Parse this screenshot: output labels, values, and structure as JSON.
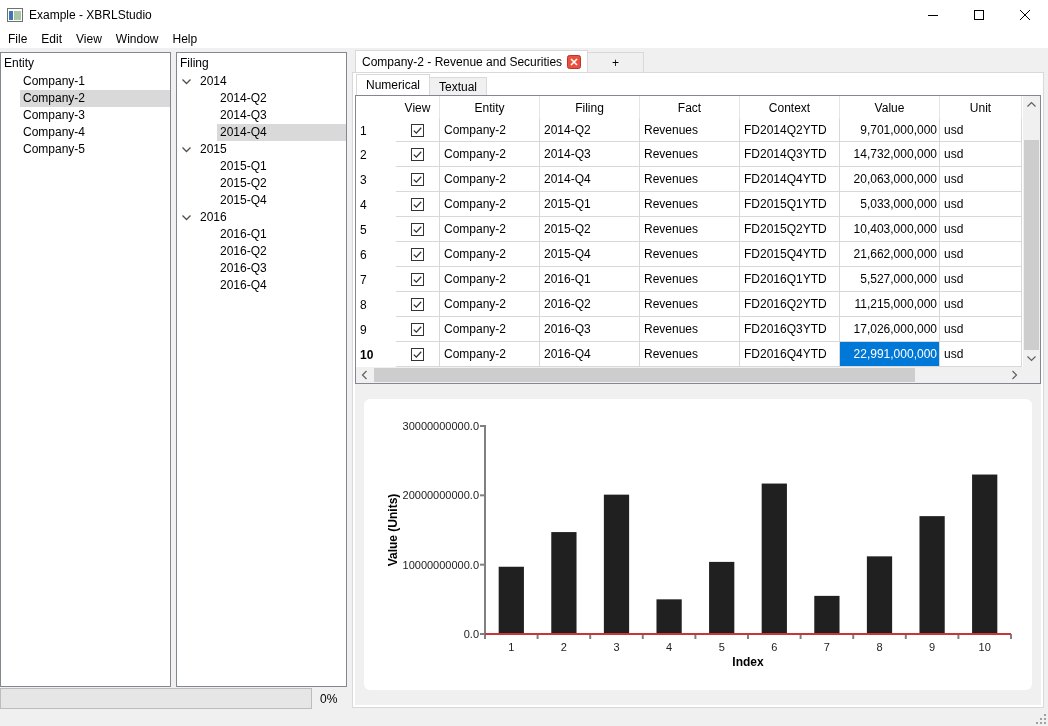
{
  "window": {
    "title": "Example - XBRLStudio"
  },
  "menu": [
    "File",
    "Edit",
    "View",
    "Window",
    "Help"
  ],
  "entity_panel": {
    "header": "Entity",
    "items": [
      {
        "label": "Company-1",
        "selected": false
      },
      {
        "label": "Company-2",
        "selected": true
      },
      {
        "label": "Company-3",
        "selected": false
      },
      {
        "label": "Company-4",
        "selected": false
      },
      {
        "label": "Company-5",
        "selected": false
      }
    ]
  },
  "filing_panel": {
    "header": "Filing",
    "items": [
      {
        "label": "2014",
        "selected": false,
        "expanded": true,
        "children": [
          {
            "label": "2014-Q2",
            "selected": false
          },
          {
            "label": "2014-Q3",
            "selected": false
          },
          {
            "label": "2014-Q4",
            "selected": true
          }
        ]
      },
      {
        "label": "2015",
        "selected": false,
        "expanded": true,
        "children": [
          {
            "label": "2015-Q1",
            "selected": false
          },
          {
            "label": "2015-Q2",
            "selected": false
          },
          {
            "label": "2015-Q4",
            "selected": false
          }
        ]
      },
      {
        "label": "2016",
        "selected": false,
        "expanded": true,
        "children": [
          {
            "label": "2016-Q1",
            "selected": false
          },
          {
            "label": "2016-Q2",
            "selected": false
          },
          {
            "label": "2016-Q3",
            "selected": false
          },
          {
            "label": "2016-Q4",
            "selected": false
          }
        ]
      }
    ]
  },
  "progress": {
    "level": 0,
    "reading": "0%"
  },
  "document_tabs": [
    {
      "label": "Company-2 - Revenue and Securities",
      "selected": true,
      "closable": true
    },
    {
      "label": "+",
      "selected": false,
      "closable": false
    }
  ],
  "view_tabs": [
    {
      "label": "Numerical",
      "selected": true
    },
    {
      "label": "Textual",
      "selected": false
    }
  ],
  "table": {
    "columns": [
      "View",
      "Entity",
      "Filing",
      "Fact",
      "Context",
      "Value",
      "Unit"
    ],
    "rows": [
      {
        "index": "1",
        "cells": [
          {
            "kind": "checkbox",
            "checked": true
          },
          {
            "kind": "text",
            "text": "Company-2",
            "selected": false
          },
          {
            "kind": "text",
            "text": "2014-Q2",
            "selected": false
          },
          {
            "kind": "text",
            "text": "Revenues",
            "selected": false
          },
          {
            "kind": "text",
            "text": "FD2014Q2YTD",
            "selected": false
          },
          {
            "kind": "number",
            "text": "9,701,000,000",
            "selected": false
          },
          {
            "kind": "text",
            "text": "usd",
            "selected": false
          }
        ]
      },
      {
        "index": "2",
        "cells": [
          {
            "kind": "checkbox",
            "checked": true
          },
          {
            "kind": "text",
            "text": "Company-2",
            "selected": false
          },
          {
            "kind": "text",
            "text": "2014-Q3",
            "selected": false
          },
          {
            "kind": "text",
            "text": "Revenues",
            "selected": false
          },
          {
            "kind": "text",
            "text": "FD2014Q3YTD",
            "selected": false
          },
          {
            "kind": "number",
            "text": "14,732,000,000",
            "selected": false
          },
          {
            "kind": "text",
            "text": "usd",
            "selected": false
          }
        ]
      },
      {
        "index": "3",
        "cells": [
          {
            "kind": "checkbox",
            "checked": true
          },
          {
            "kind": "text",
            "text": "Company-2",
            "selected": false
          },
          {
            "kind": "text",
            "text": "2014-Q4",
            "selected": false
          },
          {
            "kind": "text",
            "text": "Revenues",
            "selected": false
          },
          {
            "kind": "text",
            "text": "FD2014Q4YTD",
            "selected": false
          },
          {
            "kind": "number",
            "text": "20,063,000,000",
            "selected": false
          },
          {
            "kind": "text",
            "text": "usd",
            "selected": false
          }
        ]
      },
      {
        "index": "4",
        "cells": [
          {
            "kind": "checkbox",
            "checked": true
          },
          {
            "kind": "text",
            "text": "Company-2",
            "selected": false
          },
          {
            "kind": "text",
            "text": "2015-Q1",
            "selected": false
          },
          {
            "kind": "text",
            "text": "Revenues",
            "selected": false
          },
          {
            "kind": "text",
            "text": "FD2015Q1YTD",
            "selected": false
          },
          {
            "kind": "number",
            "text": "5,033,000,000",
            "selected": false
          },
          {
            "kind": "text",
            "text": "usd",
            "selected": false
          }
        ]
      },
      {
        "index": "5",
        "cells": [
          {
            "kind": "checkbox",
            "checked": true
          },
          {
            "kind": "text",
            "text": "Company-2",
            "selected": false
          },
          {
            "kind": "text",
            "text": "2015-Q2",
            "selected": false
          },
          {
            "kind": "text",
            "text": "Revenues",
            "selected": false
          },
          {
            "kind": "text",
            "text": "FD2015Q2YTD",
            "selected": false
          },
          {
            "kind": "number",
            "text": "10,403,000,000",
            "selected": false
          },
          {
            "kind": "text",
            "text": "usd",
            "selected": false
          }
        ]
      },
      {
        "index": "6",
        "cells": [
          {
            "kind": "checkbox",
            "checked": true
          },
          {
            "kind": "text",
            "text": "Company-2",
            "selected": false
          },
          {
            "kind": "text",
            "text": "2015-Q4",
            "selected": false
          },
          {
            "kind": "text",
            "text": "Revenues",
            "selected": false
          },
          {
            "kind": "text",
            "text": "FD2015Q4YTD",
            "selected": false
          },
          {
            "kind": "number",
            "text": "21,662,000,000",
            "selected": false
          },
          {
            "kind": "text",
            "text": "usd",
            "selected": false
          }
        ]
      },
      {
        "index": "7",
        "cells": [
          {
            "kind": "checkbox",
            "checked": true
          },
          {
            "kind": "text",
            "text": "Company-2",
            "selected": false
          },
          {
            "kind": "text",
            "text": "2016-Q1",
            "selected": false
          },
          {
            "kind": "text",
            "text": "Revenues",
            "selected": false
          },
          {
            "kind": "text",
            "text": "FD2016Q1YTD",
            "selected": false
          },
          {
            "kind": "number",
            "text": "5,527,000,000",
            "selected": false
          },
          {
            "kind": "text",
            "text": "usd",
            "selected": false
          }
        ]
      },
      {
        "index": "8",
        "cells": [
          {
            "kind": "checkbox",
            "checked": true
          },
          {
            "kind": "text",
            "text": "Company-2",
            "selected": false
          },
          {
            "kind": "text",
            "text": "2016-Q2",
            "selected": false
          },
          {
            "kind": "text",
            "text": "Revenues",
            "selected": false
          },
          {
            "kind": "text",
            "text": "FD2016Q2YTD",
            "selected": false
          },
          {
            "kind": "number",
            "text": "11,215,000,000",
            "selected": false
          },
          {
            "kind": "text",
            "text": "usd",
            "selected": false
          }
        ]
      },
      {
        "index": "9",
        "cells": [
          {
            "kind": "checkbox",
            "checked": true
          },
          {
            "kind": "text",
            "text": "Company-2",
            "selected": false
          },
          {
            "kind": "text",
            "text": "2016-Q3",
            "selected": false
          },
          {
            "kind": "text",
            "text": "Revenues",
            "selected": false
          },
          {
            "kind": "text",
            "text": "FD2016Q3YTD",
            "selected": false
          },
          {
            "kind": "number",
            "text": "17,026,000,000",
            "selected": false
          },
          {
            "kind": "text",
            "text": "usd",
            "selected": false
          }
        ]
      },
      {
        "index": "10",
        "cells": [
          {
            "kind": "checkbox",
            "checked": true
          },
          {
            "kind": "text",
            "text": "Company-2",
            "selected": false
          },
          {
            "kind": "text",
            "text": "2016-Q4",
            "selected": false
          },
          {
            "kind": "text",
            "text": "Revenues",
            "selected": false
          },
          {
            "kind": "text",
            "text": "FD2016Q4YTD",
            "selected": false
          },
          {
            "kind": "number",
            "text": "22,991,000,000",
            "selected": true
          },
          {
            "kind": "text",
            "text": "usd",
            "selected": false
          }
        ]
      }
    ]
  },
  "chart": {
    "chart_data": {
      "type": "bar",
      "xlabel": "Index",
      "ylabel": "Value (Units)",
      "categories": [
        "1",
        "2",
        "3",
        "4",
        "5",
        "6",
        "7",
        "8",
        "9",
        "10"
      ],
      "values": [
        9700000000,
        14700000000,
        20100000000,
        5000000000,
        10400000000,
        21700000000,
        5500000000,
        11200000000,
        17000000000,
        23000000000
      ],
      "color": "#202020",
      "ylim": [
        0,
        30000000000
      ],
      "yticks": [
        {
          "value": 0,
          "label": "0.0"
        },
        {
          "value": 10000000000,
          "label": "10000000000.0"
        },
        {
          "value": 20000000000,
          "label": "20000000000.0"
        },
        {
          "value": 30000000000,
          "label": "30000000000.0"
        }
      ]
    }
  }
}
